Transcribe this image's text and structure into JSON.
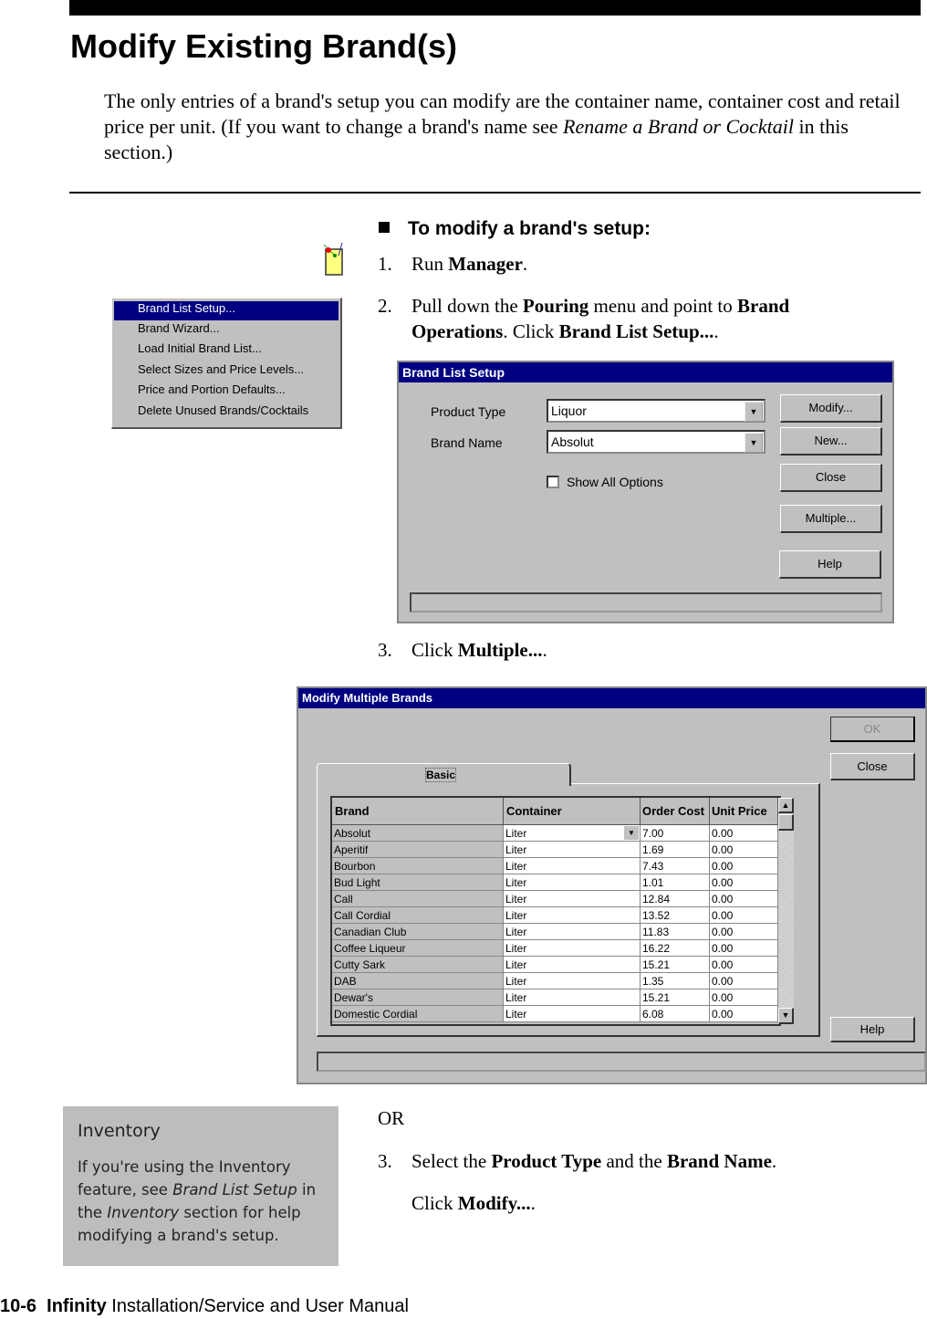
{
  "page_title": "Modify Existing Brand(s)",
  "intro": {
    "text1": "The only entries of a brand's setup you can modify are the container name, container cost and retail price per unit. (If you want to change a brand's name see ",
    "link": "Rename a Brand or Cocktail",
    "text2": " in this section.)"
  },
  "section_heading": "To modify a brand's setup:",
  "steps": [
    {
      "num": "1.",
      "a": "Run ",
      "b": "Manager",
      "c": "."
    },
    {
      "num": "2.",
      "a": "Pull down the ",
      "b": "Pouring",
      "c": " menu and point to ",
      "d": "Brand Operations",
      "e": ". Click ",
      "f": "Brand List Setup...",
      "g": "."
    },
    {
      "num": "3.",
      "a": "Click ",
      "b": "Multiple...",
      "c": "."
    },
    {
      "num": "3.",
      "a": "Select the ",
      "b": "Product Type",
      "c": " and the ",
      "d": "Brand Name",
      "e": "."
    }
  ],
  "or_label": "OR",
  "click_modify": {
    "a": "Click ",
    "b": "Modify...",
    "c": "."
  },
  "manager_icon": "cocktail-glass-icon",
  "menu": {
    "items": [
      "Brand List Setup...",
      "Brand Wizard...",
      "Load Initial Brand List...",
      "Select Sizes and Price Levels...",
      "Price and Portion Defaults...",
      "Delete Unused Brands/Cocktails"
    ],
    "selected_index": 0
  },
  "brand_list_setup": {
    "title": "Brand List Setup",
    "product_type_label": "Product Type",
    "product_type_value": "Liquor",
    "brand_name_label": "Brand Name",
    "brand_name_value": "Absolut",
    "show_all_label": "Show All Options",
    "show_all_checked": false,
    "buttons": {
      "modify": "Modify...",
      "new": "New...",
      "close": "Close",
      "multiple": "Multiple...",
      "help": "Help"
    }
  },
  "modify_multiple": {
    "title": "Modify Multiple Brands",
    "buttons": {
      "ok": "OK",
      "close": "Close",
      "help": "Help"
    },
    "tab": "Basic",
    "columns": [
      "Brand",
      "Container",
      "Order Cost",
      "Unit Price"
    ],
    "rows": [
      [
        "Absolut",
        "Liter",
        "7.00",
        "0.00"
      ],
      [
        "Aperitif",
        "Liter",
        "1.69",
        "0.00"
      ],
      [
        "Bourbon",
        "Liter",
        "7.43",
        "0.00"
      ],
      [
        "Bud Light",
        "Liter",
        "1.01",
        "0.00"
      ],
      [
        "Call",
        "Liter",
        "12.84",
        "0.00"
      ],
      [
        "Call Cordial",
        "Liter",
        "13.52",
        "0.00"
      ],
      [
        "Canadian Club",
        "Liter",
        "11.83",
        "0.00"
      ],
      [
        "Coffee Liqueur",
        "Liter",
        "16.22",
        "0.00"
      ],
      [
        "Cutty Sark",
        "Liter",
        "15.21",
        "0.00"
      ],
      [
        "DAB",
        "Liter",
        "1.35",
        "0.00"
      ],
      [
        "Dewar's",
        "Liter",
        "15.21",
        "0.00"
      ],
      [
        "Domestic Cordial",
        "Liter",
        "6.08",
        "0.00"
      ]
    ]
  },
  "note": {
    "title": "Inventory",
    "t1": "If you're using the Inventory feature, see ",
    "i1": "Brand List Setup",
    "t2": " in the ",
    "i2": "Inventory",
    "t3": " section for help modifying a brand's setup."
  },
  "footer": {
    "page": "10-6",
    "product": "Infinity",
    "rest": " Installation/Service and User Manual"
  }
}
